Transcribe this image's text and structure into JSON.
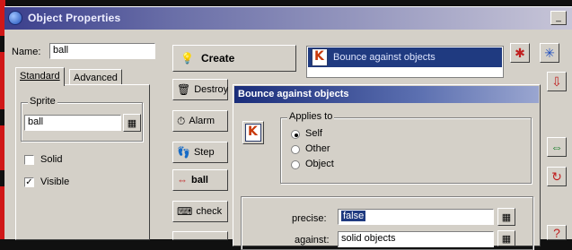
{
  "window": {
    "title": "Object Properties"
  },
  "left": {
    "name_label": "Name:",
    "name_value": "ball",
    "tabs": [
      "Standard",
      "Advanced"
    ],
    "sprite_label": "Sprite",
    "sprite_value": "ball",
    "solid_label": "Solid",
    "solid_checked": false,
    "visible_label": "Visible",
    "visible_checked": true
  },
  "create_button": "Create",
  "actions": [
    {
      "label": "Destroy",
      "icon": "trash-icon"
    },
    {
      "label": "Alarm",
      "icon": "clock-icon"
    },
    {
      "label": "Step",
      "icon": "footsteps-icon"
    },
    {
      "label": "ball",
      "icon": "collision-arrows-icon"
    },
    {
      "label": "check",
      "icon": "keyboard-icon"
    }
  ],
  "event_list": {
    "selected": "Bounce against objects"
  },
  "dialog": {
    "title": "Bounce against objects",
    "applies_to_label": "Applies to",
    "options": [
      "Self",
      "Other",
      "Object"
    ],
    "selected_option": "Self",
    "precise_label": "precise:",
    "precise_value": "false",
    "against_label": "against:",
    "against_value": "solid objects"
  },
  "colors": {
    "title_bar": "#3b3f8c",
    "selection": "#1f3a80",
    "face": "#d4d0c8"
  }
}
